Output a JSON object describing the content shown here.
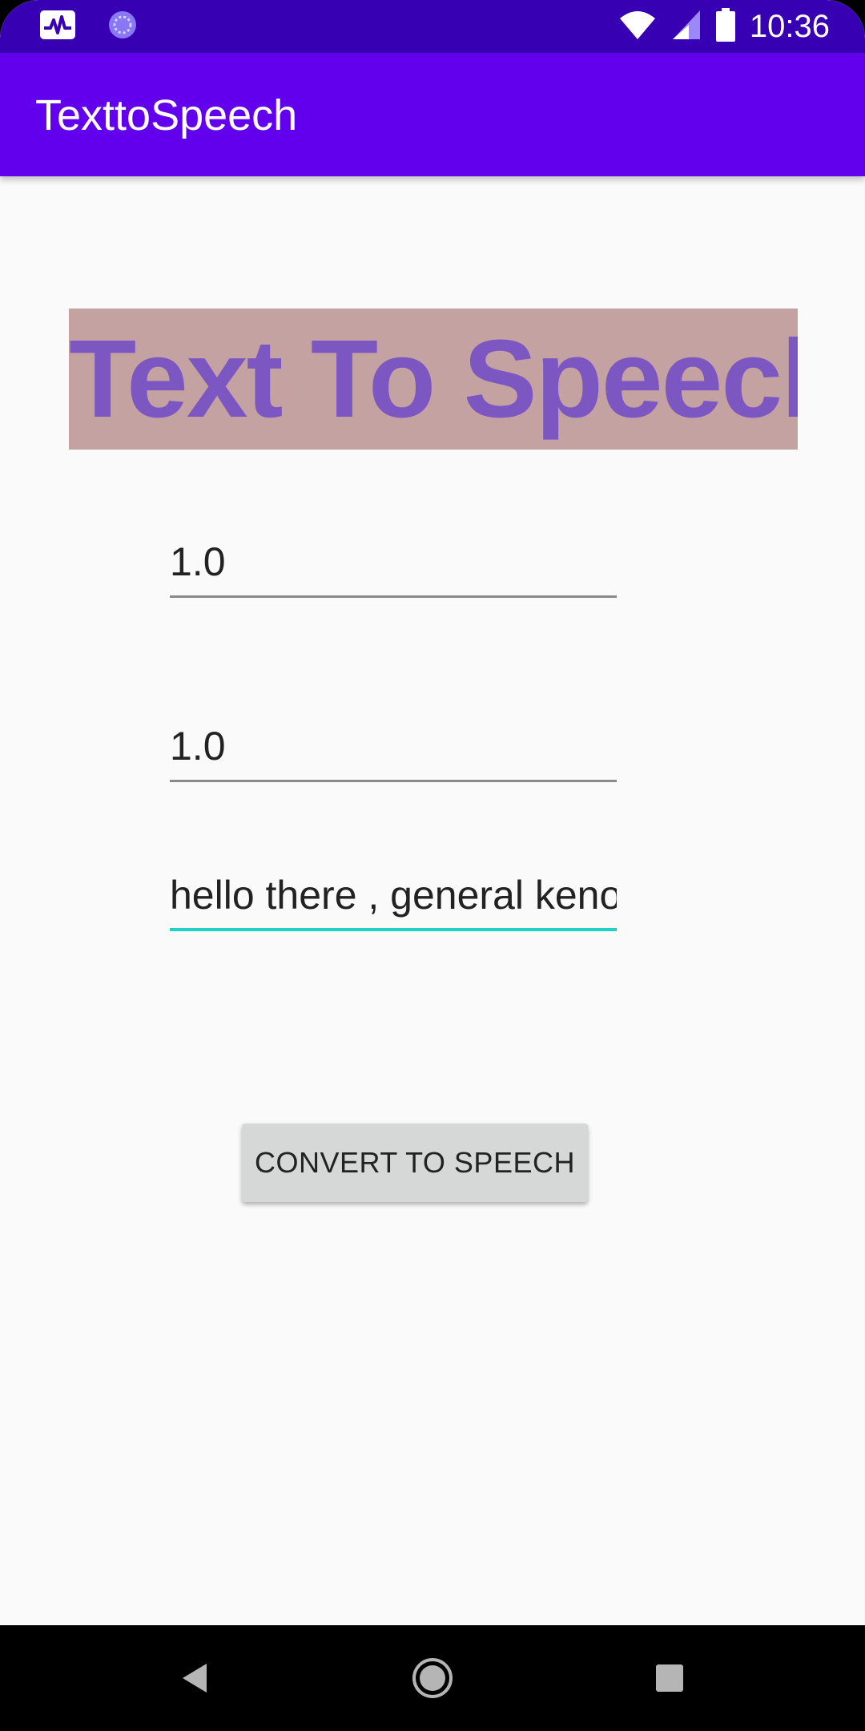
{
  "status_bar": {
    "time": "10:36",
    "icons": [
      "activity-icon",
      "sync-icon",
      "wifi-icon",
      "signal-icon",
      "battery-icon"
    ],
    "background_color": "#3700b3"
  },
  "app_bar": {
    "title": "TexttoSpeech",
    "background_color": "#6200ee"
  },
  "main": {
    "headline": "Text To Speech",
    "headline_color": "#7d57c1",
    "headline_bg": "#c4a2a2",
    "pitch_value": "1.0",
    "speed_value": "1.0",
    "text_input_value": "hello there , general keno",
    "convert_button_label": "CONVERT TO SPEECH",
    "accent_color": "#1fd1c7"
  },
  "nav_bar": {
    "icons": [
      "back-icon",
      "home-icon",
      "recents-icon"
    ]
  }
}
